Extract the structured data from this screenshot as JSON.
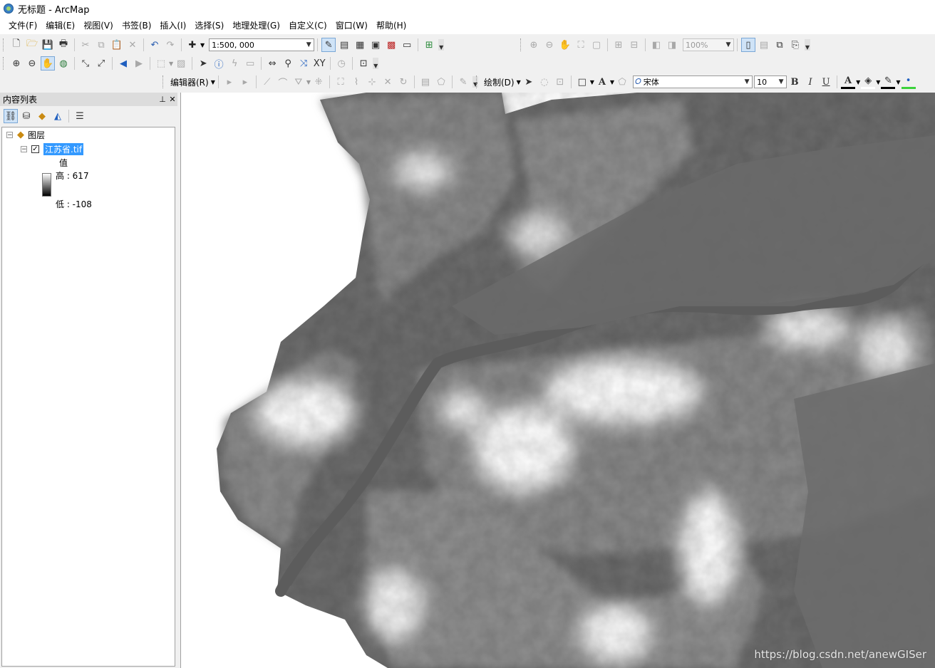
{
  "window": {
    "title": "无标题 - ArcMap"
  },
  "menu": [
    "文件(F)",
    "编辑(E)",
    "视图(V)",
    "书签(B)",
    "插入(I)",
    "选择(S)",
    "地理处理(G)",
    "自定义(C)",
    "窗口(W)",
    "帮助(H)"
  ],
  "toolbar": {
    "scale_value": "1:500, 000",
    "zoom_value": "100%",
    "editor_label": "编辑器(R)",
    "draw_label": "绘制(D)",
    "font_value": "宋体",
    "font_size_value": "10",
    "bold_label": "B",
    "italic_label": "I",
    "underline_label": "U",
    "text_tool_label": "A",
    "font_color_label": "A"
  },
  "toc": {
    "title": "内容列表",
    "root_label": "图层",
    "layer_name": "江苏省.tif",
    "legend_field": "值",
    "legend_high": "高 : 617",
    "legend_low": "低 : -108"
  },
  "map": {
    "watermark": "https://blog.csdn.net/anewGISer"
  },
  "colors": {
    "selection": "#3399ff",
    "map_mid": "#6e6e6e",
    "map_high": "#ffffff"
  }
}
